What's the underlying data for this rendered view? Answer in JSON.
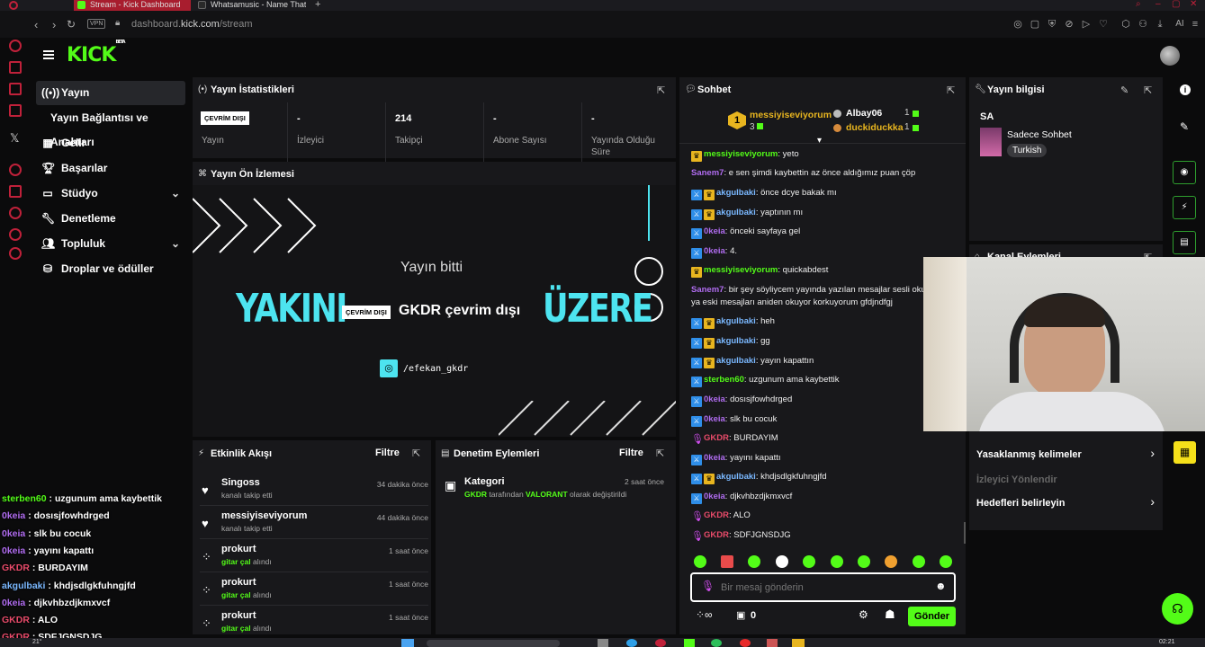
{
  "browser": {
    "tabs": [
      {
        "label": "Stream - Kick Dashboard",
        "active": true
      },
      {
        "label": "Whatsamusic - Name That",
        "active": false
      }
    ],
    "vpn_label": "VPN",
    "url_prefix": "dashboard.",
    "url_domain": "kick.com",
    "url_path": "/stream",
    "ai_label": "AI"
  },
  "header": {
    "logo_text": "KICK",
    "logo_beta": "BETA"
  },
  "nav": {
    "items": [
      {
        "label": "Yayın",
        "icon": "broadcast-icon"
      },
      {
        "label": "Yayın Bağlantısı ve Anahtarı",
        "icon": ""
      },
      {
        "label": "Gelir",
        "icon": "revenue-icon"
      },
      {
        "label": "Başarılar",
        "icon": "trophy-icon"
      },
      {
        "label": "Stüdyo",
        "icon": "studio-icon"
      },
      {
        "label": "Denetleme",
        "icon": "wrench-icon"
      },
      {
        "label": "Topluluk",
        "icon": "community-icon"
      },
      {
        "label": "Droplar ve ödüller",
        "icon": "gift-icon"
      }
    ]
  },
  "stats": {
    "title": "Yayın İstatistikleri",
    "status_badge": "ÇEVRİM DIŞI",
    "items": [
      {
        "value": "",
        "label": "Yayın"
      },
      {
        "value": "-",
        "label": "İzleyici"
      },
      {
        "value": "214",
        "label": "Takipçi"
      },
      {
        "value": "-",
        "label": "Abone Sayısı"
      },
      {
        "value": "-",
        "label": "Yayında Olduğu Süre"
      }
    ]
  },
  "preview": {
    "title": "Yayın Ön İzlemesi",
    "ended_text": "Yayın bitti",
    "big_left": "YAKINI",
    "big_right": "ÜZERE",
    "offline_badge": "ÇEVRİM DIŞI",
    "offline_text": "GKDR çevrim dışı",
    "social_handle": "/efekan_gkdr"
  },
  "activity": {
    "title": "Etkinlik Akışı",
    "filter_label": "Filtre",
    "items": [
      {
        "name": "Singoss",
        "sub": "kanalı takip etti",
        "sub_highlight": "",
        "time": "34 dakika önce",
        "icon": "heart-icon"
      },
      {
        "name": "messiyiseviyorum",
        "sub": "kanalı takip etti",
        "sub_highlight": "",
        "time": "44 dakika önce",
        "icon": "heart-icon"
      },
      {
        "name": "prokurt",
        "sub": " alındı",
        "sub_highlight": "gitar çal",
        "time": "1 saat önce",
        "icon": "points-icon"
      },
      {
        "name": "prokurt",
        "sub": " alındı",
        "sub_highlight": "gitar çal",
        "time": "1 saat önce",
        "icon": "points-icon"
      },
      {
        "name": "prokurt",
        "sub": " alındı",
        "sub_highlight": "gitar çal",
        "time": "1 saat önce",
        "icon": "points-icon"
      }
    ]
  },
  "moderation": {
    "title": "Denetim Eylemleri",
    "filter_label": "Filtre",
    "item": {
      "title": "Kategori",
      "time": "2 saat önce",
      "actor": "GKDR",
      "mid": " tarafından ",
      "category": "VALORANT",
      "tail": " olarak değiştirildi"
    }
  },
  "chat": {
    "title": "Sohbet",
    "leaderboard": {
      "rank": "1",
      "top_user": "messiyiseviyorum",
      "top_count": "3",
      "second_user": "Albay06",
      "second_count": "1",
      "third_user": "duckiduckka",
      "third_count": "1"
    },
    "messages": [
      {
        "user": "messiyiseviyorum",
        "color": "#53fc18",
        "badges": [
          "gold"
        ],
        "text": "yeto"
      },
      {
        "user": "Sanem7",
        "color": "#b06cf0",
        "badges": [],
        "text": "e sen şimdi kaybettin az önce aldığımız puan çöp"
      },
      {
        "user": "akgulbaki",
        "color": "#7ab8ff",
        "badges": [
          "blue",
          "gold"
        ],
        "text": "önce dcye bakak mı"
      },
      {
        "user": "akgulbaki",
        "color": "#7ab8ff",
        "badges": [
          "blue",
          "gold"
        ],
        "text": "yaptının mı"
      },
      {
        "user": "0keia",
        "color": "#b06cf0",
        "badges": [
          "blue"
        ],
        "text": "önceki sayfaya gel"
      },
      {
        "user": "0keia",
        "color": "#b06cf0",
        "badges": [
          "blue"
        ],
        "text": "4."
      },
      {
        "user": "messiyiseviyorum",
        "color": "#53fc18",
        "badges": [
          "gold"
        ],
        "text": "quickabdest"
      },
      {
        "user": "Sanem7",
        "color": "#b06cf0",
        "badges": [],
        "text": "bir şey söyliycem yayında yazılan mesajlar sesli oku"
      },
      {
        "user": "",
        "color": "#fff",
        "badges": [],
        "text": "ya eski mesajları aniden okuyor korkuyorum gfdjndfgj"
      },
      {
        "user": "akgulbaki",
        "color": "#7ab8ff",
        "badges": [
          "blue",
          "gold"
        ],
        "text": "heh"
      },
      {
        "user": "akgulbaki",
        "color": "#7ab8ff",
        "badges": [
          "blue",
          "gold"
        ],
        "text": "gg"
      },
      {
        "user": "akgulbaki",
        "color": "#7ab8ff",
        "badges": [
          "blue",
          "gold"
        ],
        "text": "yayın kapattın"
      },
      {
        "user": "sterben60",
        "color": "#53fc18",
        "badges": [
          "blue"
        ],
        "text": "uzgunum ama kaybettik"
      },
      {
        "user": "0keia",
        "color": "#b06cf0",
        "badges": [
          "blue"
        ],
        "text": "dosısjfowhdrged"
      },
      {
        "user": "0keia",
        "color": "#b06cf0",
        "badges": [
          "blue"
        ],
        "text": "slk bu cocuk"
      },
      {
        "user": "GKDR",
        "color": "#e84b6a",
        "badges": [
          "mic"
        ],
        "text": "BURDAYIM"
      },
      {
        "user": "0keia",
        "color": "#b06cf0",
        "badges": [
          "blue"
        ],
        "text": "yayını kapattı"
      },
      {
        "user": "akgulbaki",
        "color": "#7ab8ff",
        "badges": [
          "blue",
          "gold"
        ],
        "text": "khdjsdlgkfuhngjfd"
      },
      {
        "user": "0keia",
        "color": "#b06cf0",
        "badges": [
          "blue"
        ],
        "text": "djkvhbzdjkmxvcf"
      },
      {
        "user": "GKDR",
        "color": "#e84b6a",
        "badges": [
          "mic"
        ],
        "text": "ALO"
      },
      {
        "user": "GKDR",
        "color": "#e84b6a",
        "badges": [
          "mic"
        ],
        "text": "SDFJGNSDJG"
      }
    ],
    "input_placeholder": "Bir mesaj gönderin",
    "points": "0",
    "send_label": "Gönder"
  },
  "info": {
    "title": "Yayın bilgisi",
    "stream_title": "SA",
    "category": "Sadece Sohbet",
    "language_tag": "Turkish"
  },
  "channel_actions": {
    "title": "Kanal Eylemleri",
    "items": [
      {
        "label": "Yasaklanmış kelimeler",
        "enabled": true
      },
      {
        "label": "İzleyici Yönlendir",
        "enabled": false
      },
      {
        "label": "Hedefleri belirleyin",
        "enabled": true
      }
    ]
  },
  "overlay_chat": [
    {
      "user": "sterben60",
      "text": " uzgunum ama kaybettik",
      "color": "#53fc18"
    },
    {
      "user": "0keia",
      "text": " dosısjfowhdrged",
      "color": "#b06cf0"
    },
    {
      "user": "0keia",
      "text": " slk bu cocuk",
      "color": "#b06cf0"
    },
    {
      "user": "0keia",
      "text": " yayını kapattı",
      "color": "#b06cf0"
    },
    {
      "user": "GKDR",
      "text": " BURDAYIM",
      "color": "#e84b6a"
    },
    {
      "user": "akgulbaki",
      "text": " khdjsdlgkfuhngjfd",
      "color": "#7ab8ff"
    },
    {
      "user": "0keia",
      "text": " djkvhbzdjkmxvcf",
      "color": "#b06cf0"
    },
    {
      "user": "GKDR",
      "text": " ALO",
      "color": "#e84b6a"
    },
    {
      "user": "GKDR",
      "text": " SDFJGNSDJG",
      "color": "#e84b6a"
    }
  ],
  "taskbar": {
    "temp": "21°",
    "time": "02:21"
  },
  "colors": {
    "accent": "#53fc18",
    "panel": "#18181b",
    "offline_cyan": "#4de4f0"
  }
}
